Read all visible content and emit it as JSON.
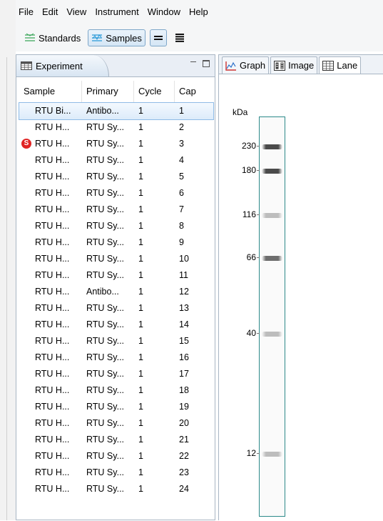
{
  "menu": [
    "File",
    "Edit",
    "View",
    "Instrument",
    "Window",
    "Help"
  ],
  "toolbar": {
    "standards_label": "Standards",
    "samples_label": "Samples"
  },
  "experiment_panel": {
    "title": "Experiment",
    "columns": [
      "Sample",
      "Primary",
      "Cycle",
      "Cap"
    ],
    "rows": [
      {
        "sample": "RTU Bi...",
        "primary": "Antibo...",
        "cycle": "1",
        "cap": "1",
        "selected": true
      },
      {
        "sample": "RTU H...",
        "primary": "RTU Sy...",
        "cycle": "1",
        "cap": "2"
      },
      {
        "sample": "RTU H...",
        "primary": "RTU Sy...",
        "cycle": "1",
        "cap": "3",
        "flag": "S"
      },
      {
        "sample": "RTU H...",
        "primary": "RTU Sy...",
        "cycle": "1",
        "cap": "4"
      },
      {
        "sample": "RTU H...",
        "primary": "RTU Sy...",
        "cycle": "1",
        "cap": "5"
      },
      {
        "sample": "RTU H...",
        "primary": "RTU Sy...",
        "cycle": "1",
        "cap": "6"
      },
      {
        "sample": "RTU H...",
        "primary": "RTU Sy...",
        "cycle": "1",
        "cap": "7"
      },
      {
        "sample": "RTU H...",
        "primary": "RTU Sy...",
        "cycle": "1",
        "cap": "8"
      },
      {
        "sample": "RTU H...",
        "primary": "RTU Sy...",
        "cycle": "1",
        "cap": "9"
      },
      {
        "sample": "RTU H...",
        "primary": "RTU Sy...",
        "cycle": "1",
        "cap": "10"
      },
      {
        "sample": "RTU H...",
        "primary": "RTU Sy...",
        "cycle": "1",
        "cap": "11"
      },
      {
        "sample": "RTU H...",
        "primary": "Antibo...",
        "cycle": "1",
        "cap": "12"
      },
      {
        "sample": "RTU H...",
        "primary": "RTU Sy...",
        "cycle": "1",
        "cap": "13"
      },
      {
        "sample": "RTU H...",
        "primary": "RTU Sy...",
        "cycle": "1",
        "cap": "14"
      },
      {
        "sample": "RTU H...",
        "primary": "RTU Sy...",
        "cycle": "1",
        "cap": "15"
      },
      {
        "sample": "RTU H...",
        "primary": "RTU Sy...",
        "cycle": "1",
        "cap": "16"
      },
      {
        "sample": "RTU H...",
        "primary": "RTU Sy...",
        "cycle": "1",
        "cap": "17"
      },
      {
        "sample": "RTU H...",
        "primary": "RTU Sy...",
        "cycle": "1",
        "cap": "18"
      },
      {
        "sample": "RTU H...",
        "primary": "RTU Sy...",
        "cycle": "1",
        "cap": "19"
      },
      {
        "sample": "RTU H...",
        "primary": "RTU Sy...",
        "cycle": "1",
        "cap": "20"
      },
      {
        "sample": "RTU H...",
        "primary": "RTU Sy...",
        "cycle": "1",
        "cap": "21"
      },
      {
        "sample": "RTU H...",
        "primary": "RTU Sy...",
        "cycle": "1",
        "cap": "22"
      },
      {
        "sample": "RTU H...",
        "primary": "RTU Sy...",
        "cycle": "1",
        "cap": "23"
      },
      {
        "sample": "RTU H...",
        "primary": "RTU Sy...",
        "cycle": "1",
        "cap": "24"
      }
    ]
  },
  "view_tabs": [
    {
      "label": "Graph",
      "icon": "graph-icon"
    },
    {
      "label": "Image",
      "icon": "image-icon"
    },
    {
      "label": "Lane",
      "icon": "lane-icon",
      "active": true
    }
  ],
  "lane_view": {
    "unit_label": "kDa",
    "markers": [
      {
        "label": "230",
        "intensity": "strong"
      },
      {
        "label": "180",
        "intensity": "strong"
      },
      {
        "label": "116",
        "intensity": "faint"
      },
      {
        "label": "66",
        "intensity": "medium"
      },
      {
        "label": "40",
        "intensity": "faint"
      },
      {
        "label": "12",
        "intensity": "faint"
      }
    ],
    "colors": {
      "lane_border": "#2c8a8a",
      "strong_band": "#4a4a4a",
      "medium_band": "#6e6e6e",
      "faint_band": "#bdbdbd"
    }
  }
}
